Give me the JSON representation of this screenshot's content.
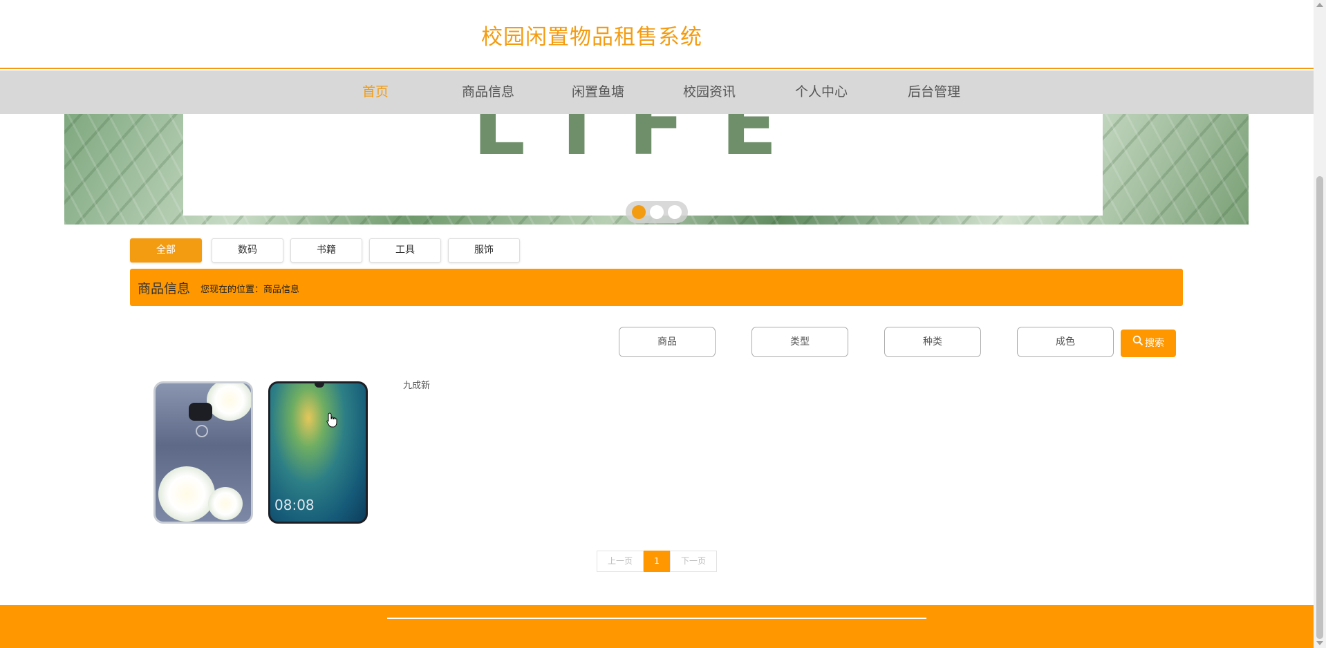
{
  "header": {
    "site_title": "校园闲置物品租售系统"
  },
  "nav": {
    "items": [
      {
        "label": "首页",
        "active": true
      },
      {
        "label": "商品信息"
      },
      {
        "label": "闲置鱼塘"
      },
      {
        "label": "校园资讯"
      },
      {
        "label": "个人中心"
      },
      {
        "label": "后台管理"
      }
    ]
  },
  "banner": {
    "word": "LIFE",
    "active_slide": 1,
    "slide_count": 3
  },
  "categories": [
    {
      "label": "全部",
      "active": true
    },
    {
      "label": "数码"
    },
    {
      "label": "书籍"
    },
    {
      "label": "工具"
    },
    {
      "label": "服饰"
    }
  ],
  "info_bar": {
    "title": "商品信息",
    "location": "您现在的位置：商品信息"
  },
  "filters": {
    "product_placeholder": "商品",
    "type_placeholder": "类型",
    "kind_placeholder": "种类",
    "condition_placeholder": "成色",
    "search_label": "搜索"
  },
  "products": [
    {
      "condition": "九成新",
      "screen_time": "08:08"
    }
  ],
  "pagination": {
    "prev_label": "上一页",
    "current_page": "1",
    "next_label": "下一页"
  },
  "colors": {
    "accent": "#ff9800",
    "title": "#f39c12",
    "nav_bg": "#d8d8d8"
  }
}
